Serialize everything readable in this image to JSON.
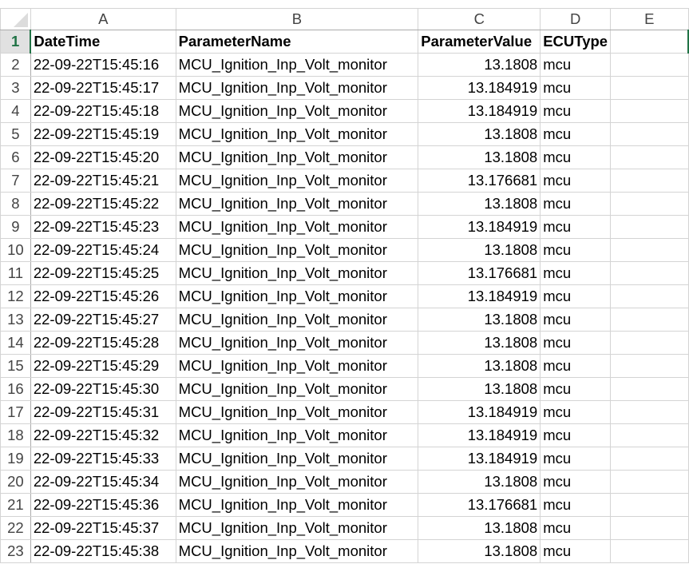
{
  "columns": [
    "A",
    "B",
    "C",
    "D",
    "E"
  ],
  "header": {
    "row": "1",
    "cells": [
      "DateTime",
      "ParameterName",
      "ParameterValue",
      "ECUType",
      ""
    ]
  },
  "rows": [
    {
      "n": "2",
      "t": "22-09-22T15:45:16",
      "p": "MCU_Ignition_Inp_Volt_monitor",
      "v": "13.1808",
      "e": "mcu"
    },
    {
      "n": "3",
      "t": "22-09-22T15:45:17",
      "p": "MCU_Ignition_Inp_Volt_monitor",
      "v": "13.184919",
      "e": "mcu"
    },
    {
      "n": "4",
      "t": "22-09-22T15:45:18",
      "p": "MCU_Ignition_Inp_Volt_monitor",
      "v": "13.184919",
      "e": "mcu"
    },
    {
      "n": "5",
      "t": "22-09-22T15:45:19",
      "p": "MCU_Ignition_Inp_Volt_monitor",
      "v": "13.1808",
      "e": "mcu"
    },
    {
      "n": "6",
      "t": "22-09-22T15:45:20",
      "p": "MCU_Ignition_Inp_Volt_monitor",
      "v": "13.1808",
      "e": "mcu"
    },
    {
      "n": "7",
      "t": "22-09-22T15:45:21",
      "p": "MCU_Ignition_Inp_Volt_monitor",
      "v": "13.176681",
      "e": "mcu"
    },
    {
      "n": "8",
      "t": "22-09-22T15:45:22",
      "p": "MCU_Ignition_Inp_Volt_monitor",
      "v": "13.1808",
      "e": "mcu"
    },
    {
      "n": "9",
      "t": "22-09-22T15:45:23",
      "p": "MCU_Ignition_Inp_Volt_monitor",
      "v": "13.184919",
      "e": "mcu"
    },
    {
      "n": "10",
      "t": "22-09-22T15:45:24",
      "p": "MCU_Ignition_Inp_Volt_monitor",
      "v": "13.1808",
      "e": "mcu"
    },
    {
      "n": "11",
      "t": "22-09-22T15:45:25",
      "p": "MCU_Ignition_Inp_Volt_monitor",
      "v": "13.176681",
      "e": "mcu"
    },
    {
      "n": "12",
      "t": "22-09-22T15:45:26",
      "p": "MCU_Ignition_Inp_Volt_monitor",
      "v": "13.184919",
      "e": "mcu"
    },
    {
      "n": "13",
      "t": "22-09-22T15:45:27",
      "p": "MCU_Ignition_Inp_Volt_monitor",
      "v": "13.1808",
      "e": "mcu"
    },
    {
      "n": "14",
      "t": "22-09-22T15:45:28",
      "p": "MCU_Ignition_Inp_Volt_monitor",
      "v": "13.1808",
      "e": "mcu"
    },
    {
      "n": "15",
      "t": "22-09-22T15:45:29",
      "p": "MCU_Ignition_Inp_Volt_monitor",
      "v": "13.1808",
      "e": "mcu"
    },
    {
      "n": "16",
      "t": "22-09-22T15:45:30",
      "p": "MCU_Ignition_Inp_Volt_monitor",
      "v": "13.1808",
      "e": "mcu"
    },
    {
      "n": "17",
      "t": "22-09-22T15:45:31",
      "p": "MCU_Ignition_Inp_Volt_monitor",
      "v": "13.184919",
      "e": "mcu"
    },
    {
      "n": "18",
      "t": "22-09-22T15:45:32",
      "p": "MCU_Ignition_Inp_Volt_monitor",
      "v": "13.184919",
      "e": "mcu"
    },
    {
      "n": "19",
      "t": "22-09-22T15:45:33",
      "p": "MCU_Ignition_Inp_Volt_monitor",
      "v": "13.184919",
      "e": "mcu"
    },
    {
      "n": "20",
      "t": "22-09-22T15:45:34",
      "p": "MCU_Ignition_Inp_Volt_monitor",
      "v": "13.1808",
      "e": "mcu"
    },
    {
      "n": "21",
      "t": "22-09-22T15:45:36",
      "p": "MCU_Ignition_Inp_Volt_monitor",
      "v": "13.176681",
      "e": "mcu"
    },
    {
      "n": "22",
      "t": "22-09-22T15:45:37",
      "p": "MCU_Ignition_Inp_Volt_monitor",
      "v": "13.1808",
      "e": "mcu"
    },
    {
      "n": "23",
      "t": "22-09-22T15:45:38",
      "p": "MCU_Ignition_Inp_Volt_monitor",
      "v": "13.1808",
      "e": "mcu"
    }
  ]
}
